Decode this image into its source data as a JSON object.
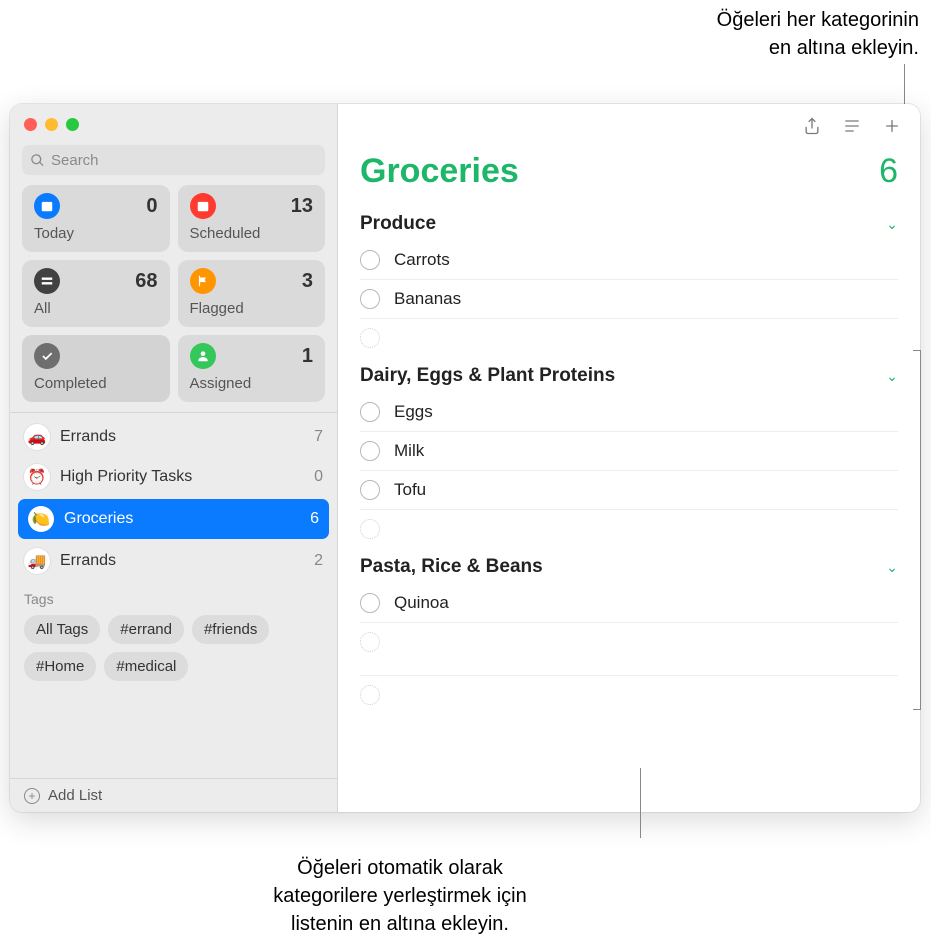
{
  "callouts": {
    "top": "Öğeleri her kategorinin\nen altına ekleyin.",
    "bottom": "Öğeleri otomatik olarak\nkategorilere yerleştirmek için\nlistenin en altına ekleyin."
  },
  "sidebar": {
    "search_placeholder": "Search",
    "smart": {
      "today": {
        "label": "Today",
        "count": "0"
      },
      "scheduled": {
        "label": "Scheduled",
        "count": "13"
      },
      "all": {
        "label": "All",
        "count": "68"
      },
      "flagged": {
        "label": "Flagged",
        "count": "3"
      },
      "completed": {
        "label": "Completed",
        "count": ""
      },
      "assigned": {
        "label": "Assigned",
        "count": "1"
      }
    },
    "lists": [
      {
        "name": "Errands",
        "count": "7",
        "emoji": "🚗"
      },
      {
        "name": "High Priority Tasks",
        "count": "0",
        "emoji": "⏰"
      },
      {
        "name": "Groceries",
        "count": "6",
        "emoji": "🍋"
      },
      {
        "name": "Errands",
        "count": "2",
        "emoji": "🚚"
      }
    ],
    "tags_label": "Tags",
    "tags": [
      "All Tags",
      "#errand",
      "#friends",
      "#Home",
      "#medical"
    ],
    "add_list": "Add List"
  },
  "main": {
    "title": "Groceries",
    "count": "6",
    "accent": "#1eb668",
    "sections": [
      {
        "title": "Produce",
        "items": [
          "Carrots",
          "Bananas"
        ]
      },
      {
        "title": "Dairy, Eggs & Plant Proteins",
        "items": [
          "Eggs",
          "Milk",
          "Tofu"
        ]
      },
      {
        "title": "Pasta, Rice & Beans",
        "items": [
          "Quinoa"
        ]
      }
    ]
  }
}
